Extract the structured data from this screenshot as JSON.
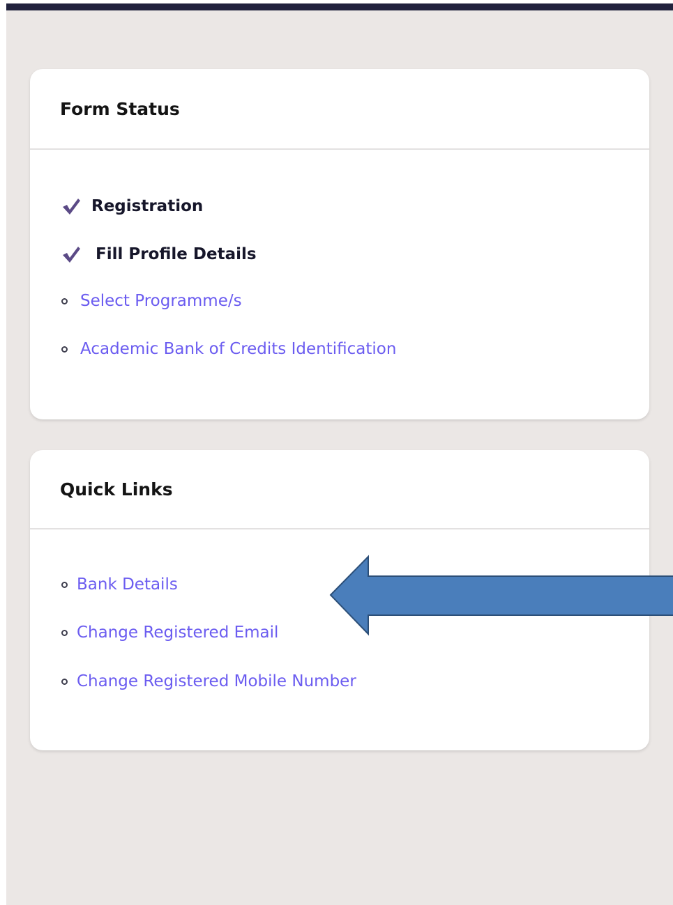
{
  "form_status": {
    "title": "Form Status",
    "completed_items": [
      {
        "label": "Registration",
        "icon": "check-icon"
      },
      {
        "label": "Fill Profile Details",
        "icon": "check-icon"
      }
    ],
    "pending_items": [
      {
        "label": "Select Programme/s",
        "icon": "bullet-icon"
      },
      {
        "label": "Academic Bank of Credits Identification",
        "icon": "bullet-icon"
      }
    ]
  },
  "quick_links": {
    "title": "Quick Links",
    "items": [
      {
        "label": "Bank Details",
        "icon": "bullet-icon"
      },
      {
        "label": "Change Registered Email",
        "icon": "bullet-icon"
      },
      {
        "label": "Change Registered Mobile Number",
        "icon": "bullet-icon"
      }
    ]
  },
  "annotation": {
    "icon": "left-arrow-icon",
    "fill_color": "#4a7ebb",
    "stroke_color": "#2c4f78"
  },
  "colors": {
    "top_bar": "#21223d",
    "page_background": "#ebe7e5",
    "link": "#6b5cf0",
    "check": "#5b4a86"
  }
}
